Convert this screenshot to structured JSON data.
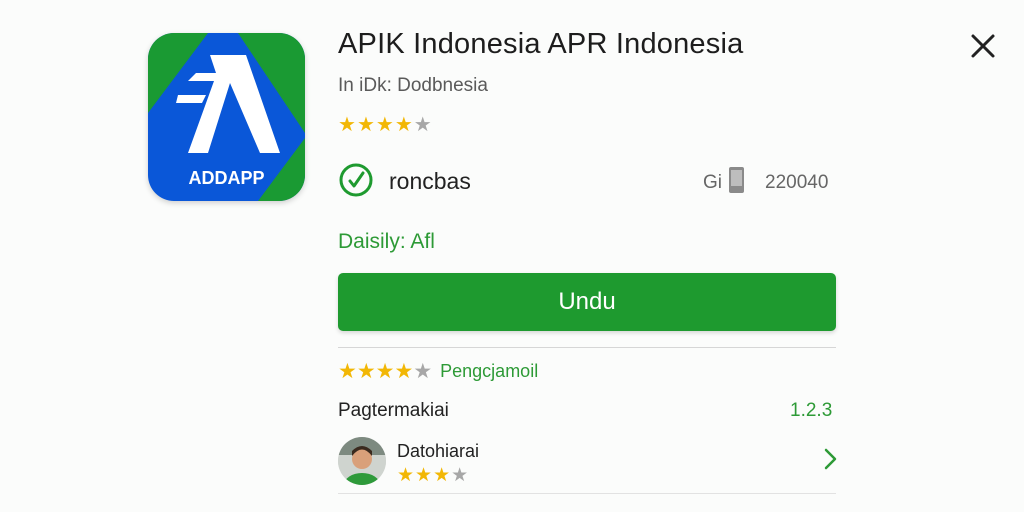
{
  "app": {
    "title": "APIK Indonesia APR Indonesia",
    "subtitle": "In iDk: Dodbnesia",
    "icon_label": "ADDAPP",
    "icon_colors": [
      "#1a8a2e",
      "#0a57d8",
      "#ffffff"
    ]
  },
  "rating_top": {
    "filled": 4,
    "total": 5
  },
  "developer": {
    "icon": "checkmark-circle-icon",
    "name": "roncbas"
  },
  "size": {
    "unit": "Gi",
    "icon": "phone-icon",
    "value": "220040"
  },
  "category": "Daisily: Afl",
  "download": {
    "label": "Undu"
  },
  "ratings_row": {
    "filled": 4,
    "total": 5,
    "link": "Pengcjamoil"
  },
  "version": {
    "label": "Pagtermakiai",
    "value": "1.2.3"
  },
  "review": {
    "reviewer": "Datohiarai",
    "filled": 3,
    "total": 4
  },
  "colors": {
    "accent": "#1e9a2f",
    "star": "#f2b705",
    "text_green": "#2d9a36"
  }
}
